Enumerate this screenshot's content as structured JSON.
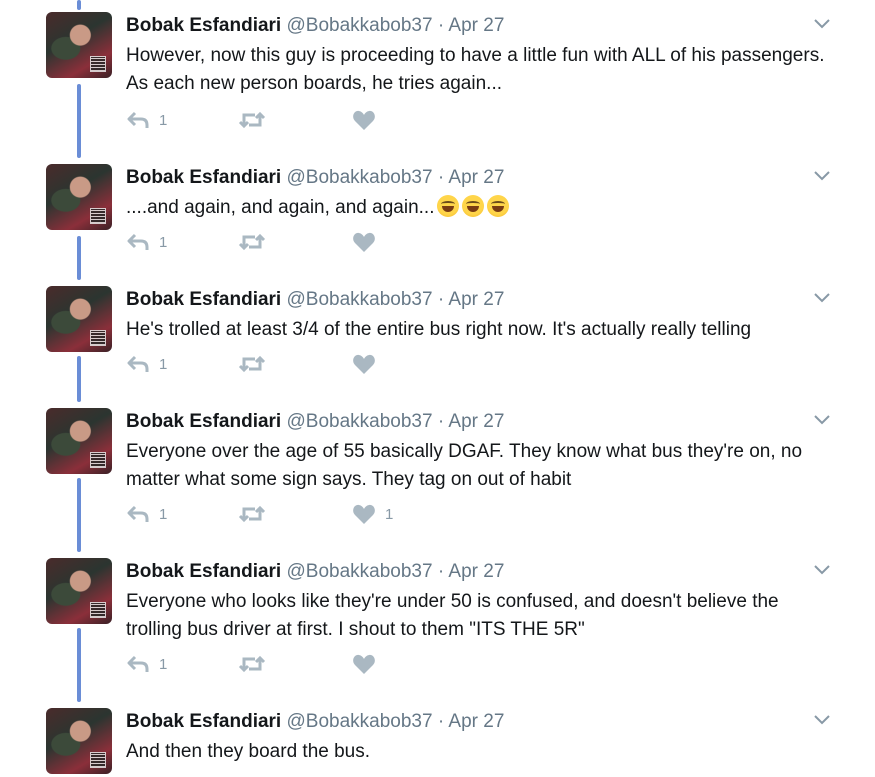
{
  "accent_color": "#6a8dd6",
  "icons": {
    "reply": "reply-arrow-icon",
    "retweet": "retweet-icon",
    "like": "heart-icon",
    "menu": "chevron-down-icon",
    "emoji": "grinning-squinting-face-emoji"
  },
  "tweets": [
    {
      "name": "Bobak Esfandiari",
      "handle": "@Bobakkabob37",
      "separator": "·",
      "date": "Apr 27",
      "text": "However, now this guy is proceeding to have a little fun with ALL of his passengers. As each new person boards, he tries again...",
      "reply_count": "1",
      "retweet_count": "",
      "like_count": ""
    },
    {
      "name": "Bobak Esfandiari",
      "handle": "@Bobakkabob37",
      "separator": "·",
      "date": "Apr 27",
      "text": "....and again, and again, and again...",
      "emoji_count": 3,
      "reply_count": "1",
      "retweet_count": "",
      "like_count": ""
    },
    {
      "name": "Bobak Esfandiari",
      "handle": "@Bobakkabob37",
      "separator": "·",
      "date": "Apr 27",
      "text": "He's trolled at least 3/4 of the entire bus right now. It's actually really telling",
      "reply_count": "1",
      "retweet_count": "",
      "like_count": ""
    },
    {
      "name": "Bobak Esfandiari",
      "handle": "@Bobakkabob37",
      "separator": "·",
      "date": "Apr 27",
      "text": "Everyone over the age of 55 basically DGAF. They know what bus they're on, no matter what some sign says. They tag on out of habit",
      "reply_count": "1",
      "retweet_count": "",
      "like_count": "1"
    },
    {
      "name": "Bobak Esfandiari",
      "handle": "@Bobakkabob37",
      "separator": "·",
      "date": "Apr 27",
      "text": "Everyone who looks like they're under 50 is confused, and doesn't believe the trolling bus driver at first. I shout to them \"ITS THE 5R\"",
      "reply_count": "1",
      "retweet_count": "",
      "like_count": ""
    },
    {
      "name": "Bobak Esfandiari",
      "handle": "@Bobakkabob37",
      "separator": "·",
      "date": "Apr 27",
      "text": "And then they board the bus."
    }
  ]
}
